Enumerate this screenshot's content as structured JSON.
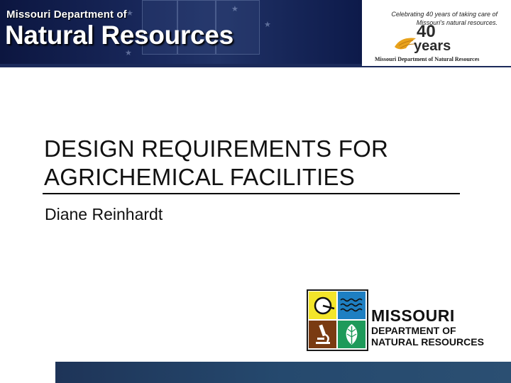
{
  "banner": {
    "org_small": "Missouri Department of",
    "org_big": "Natural Resources",
    "colors": {
      "navy": "#101c45"
    }
  },
  "anniversary": {
    "caption": "Celebrating 40 years of taking care of Missouri's natural resources.",
    "number": "40",
    "years": "years",
    "footer": "Missouri Department of Natural Resources",
    "icon": "hand-leaf-icon",
    "colors": {
      "gold": "#e8a21c"
    }
  },
  "slide": {
    "title_line1": "DESIGN REQUIREMENTS FOR",
    "title_line2": "AGRICHEMICAL FACILITIES",
    "presenter": "Diane Reinhardt"
  },
  "logo": {
    "line1": "MISSOURI",
    "line2": "DEPARTMENT OF",
    "line3": "NATURAL RESOURCES",
    "quadrants": [
      {
        "icon": "sun-landscape-icon",
        "color": "#f3e52a"
      },
      {
        "icon": "water-waves-icon",
        "color": "#1e7fc2"
      },
      {
        "icon": "microscope-icon",
        "color": "#7a3b12"
      },
      {
        "icon": "leaf-icon",
        "color": "#1e9a5a"
      }
    ]
  }
}
